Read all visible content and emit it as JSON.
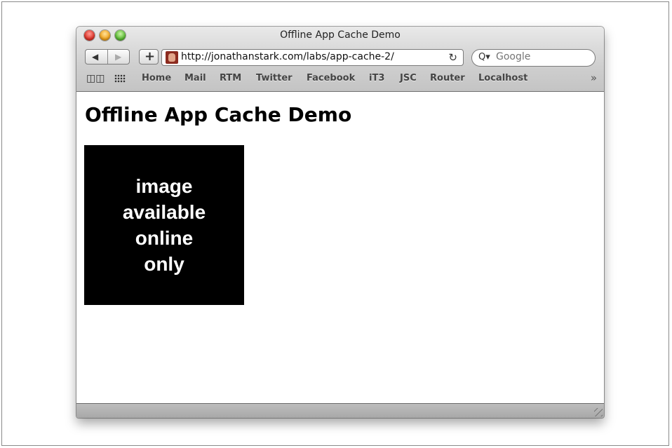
{
  "window": {
    "title": "Offline App Cache Demo"
  },
  "toolbar": {
    "back_glyph": "◀",
    "forward_glyph": "▶",
    "add_glyph": "+",
    "url": "http://jonathanstark.com/labs/app-cache-2/",
    "reload_glyph": "↻",
    "search_placeholder": "Google",
    "search_glyph": "Q▾"
  },
  "bookmarks": {
    "items": [
      "Home",
      "Mail",
      "RTM",
      "Twitter",
      "Facebook",
      "iT3",
      "JSC",
      "Router",
      "Localhost"
    ],
    "more_glyph": "»",
    "book_glyph": "📖"
  },
  "page": {
    "heading": "Offline App Cache Demo",
    "image_text": [
      "image",
      "available",
      "online",
      "only"
    ]
  },
  "colors": {
    "close": "#e0352b",
    "minimize": "#f2a51f",
    "maximize": "#5cbd35",
    "image_bg": "#000000"
  },
  "icons": [
    "close-icon",
    "minimize-icon",
    "maximize-icon",
    "back-arrow-icon",
    "forward-arrow-icon",
    "add-bookmark-icon",
    "favicon-icon",
    "reload-icon",
    "search-icon",
    "bookmarks-book-icon",
    "top-sites-grid-icon",
    "overflow-chevron-icon",
    "resize-grip-icon"
  ]
}
